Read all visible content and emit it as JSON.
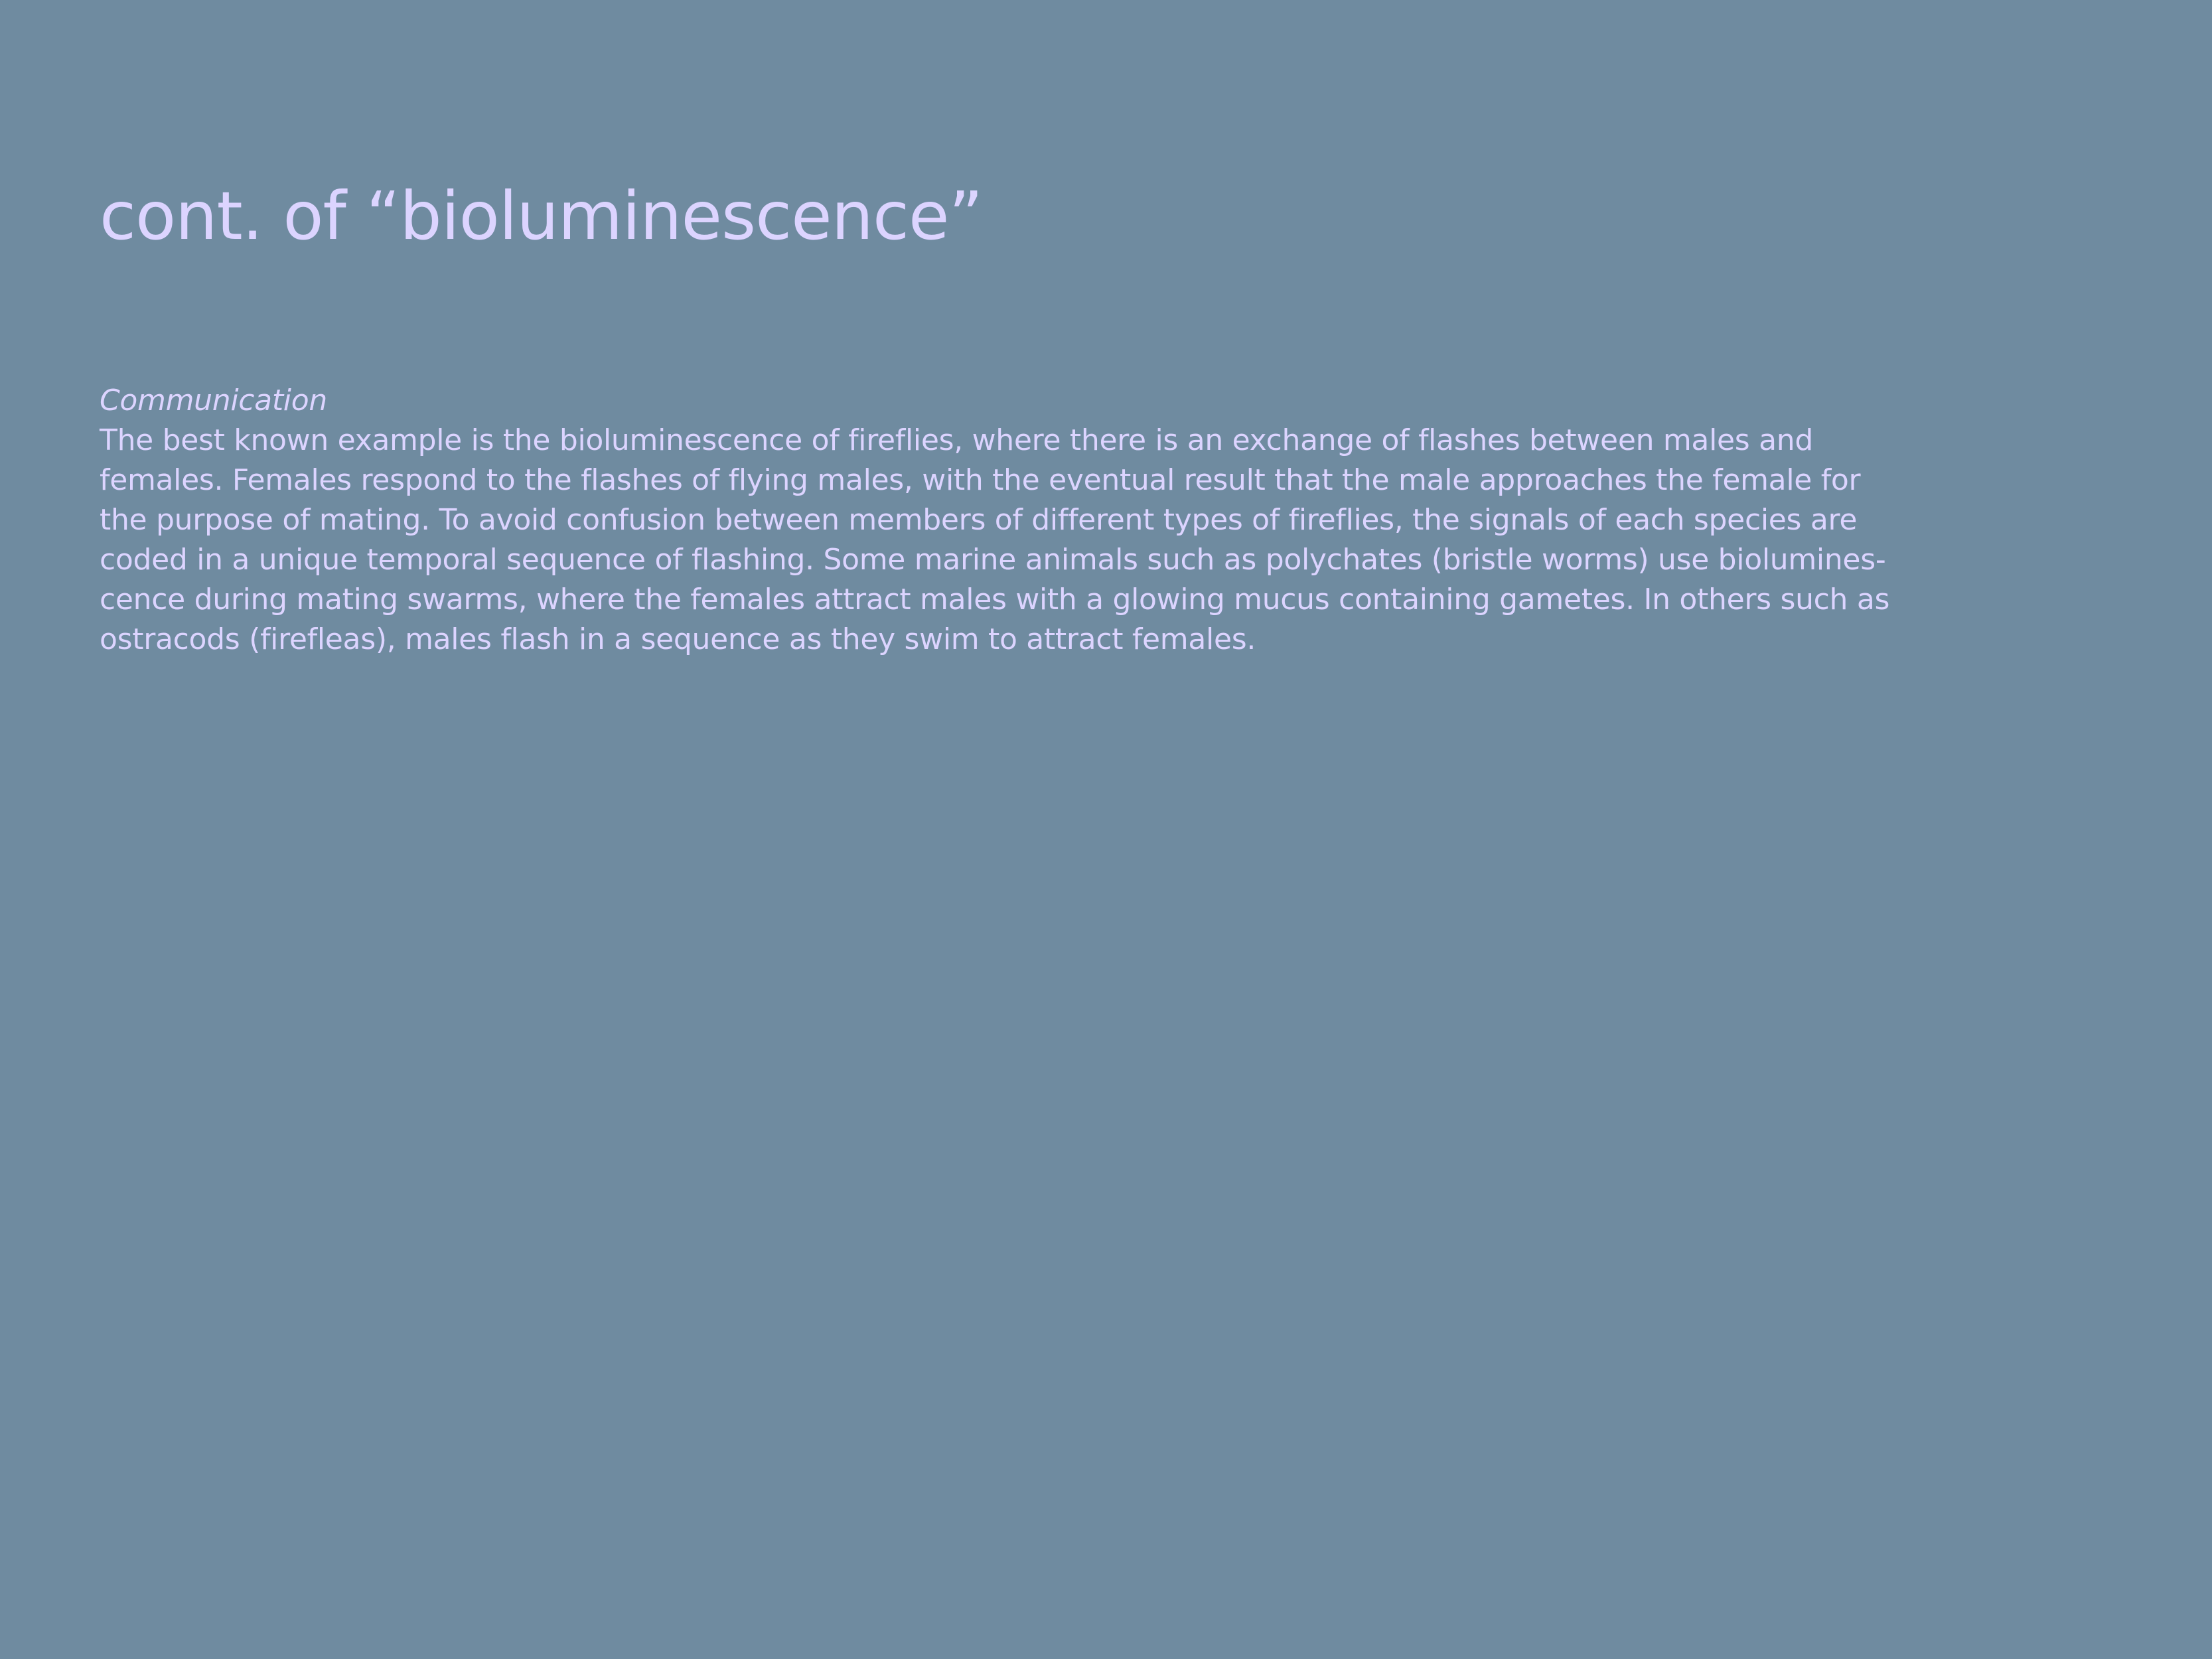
{
  "slide": {
    "title": "cont. of “bioluminescence”",
    "section": {
      "heading": "Communication",
      "body_lines": [
        "The best known example is the bioluminescence of fireflies, where there is an exchange of flashes between males and",
        "females. Females respond to the flashes of flying males, with the eventual result that the male approaches the female for",
        "the purpose of mating. To avoid confusion between members of different types of fireflies, the signals of each species are",
        "coded in a unique temporal sequence of flashing. Some marine animals such as polychates (bristle worms) use biolumines-",
        "cence during mating swarms, where the females attract males with a glowing mucus containing gametes. In others such as",
        "ostracods (firefleas), males flash in a sequence as they swim to attract females."
      ]
    }
  },
  "colors": {
    "background": "#6f8ba0",
    "text": "#dcd4ff"
  }
}
